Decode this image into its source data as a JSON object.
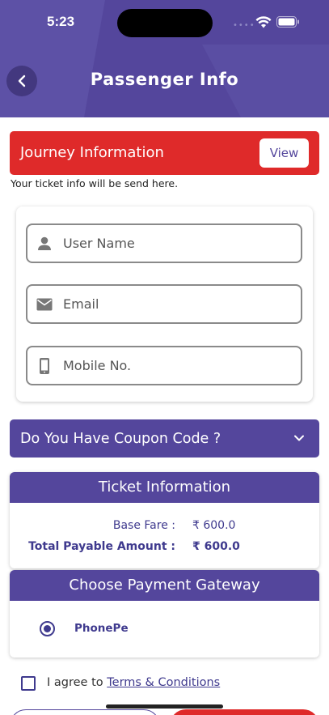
{
  "status_bar": {
    "time": "5:23",
    "dots": "••••"
  },
  "header": {
    "title": "Passenger Info"
  },
  "journey": {
    "title": "Journey Information",
    "view_label": "View",
    "note": "Your ticket info will be send here."
  },
  "form": {
    "username_placeholder": "User Name",
    "email_placeholder": "Email",
    "mobile_placeholder": "Mobile No."
  },
  "coupon": {
    "label": "Do You Have Coupon Code ?"
  },
  "ticket_info": {
    "title": "Ticket Information",
    "base_fare_label": "Base Fare :",
    "base_fare_value": "₹ 600.0",
    "total_label": "Total Payable Amount :",
    "total_value": "₹ 600.0"
  },
  "payment": {
    "title": "Choose Payment Gateway",
    "selected_gateway": "PhonePe"
  },
  "agree": {
    "prefix": "I agree to ",
    "link": "Terms & Conditions"
  },
  "colors": {
    "primary": "#54469c",
    "accent_red": "#df2a2a",
    "text_purple": "#3f3a8e"
  }
}
